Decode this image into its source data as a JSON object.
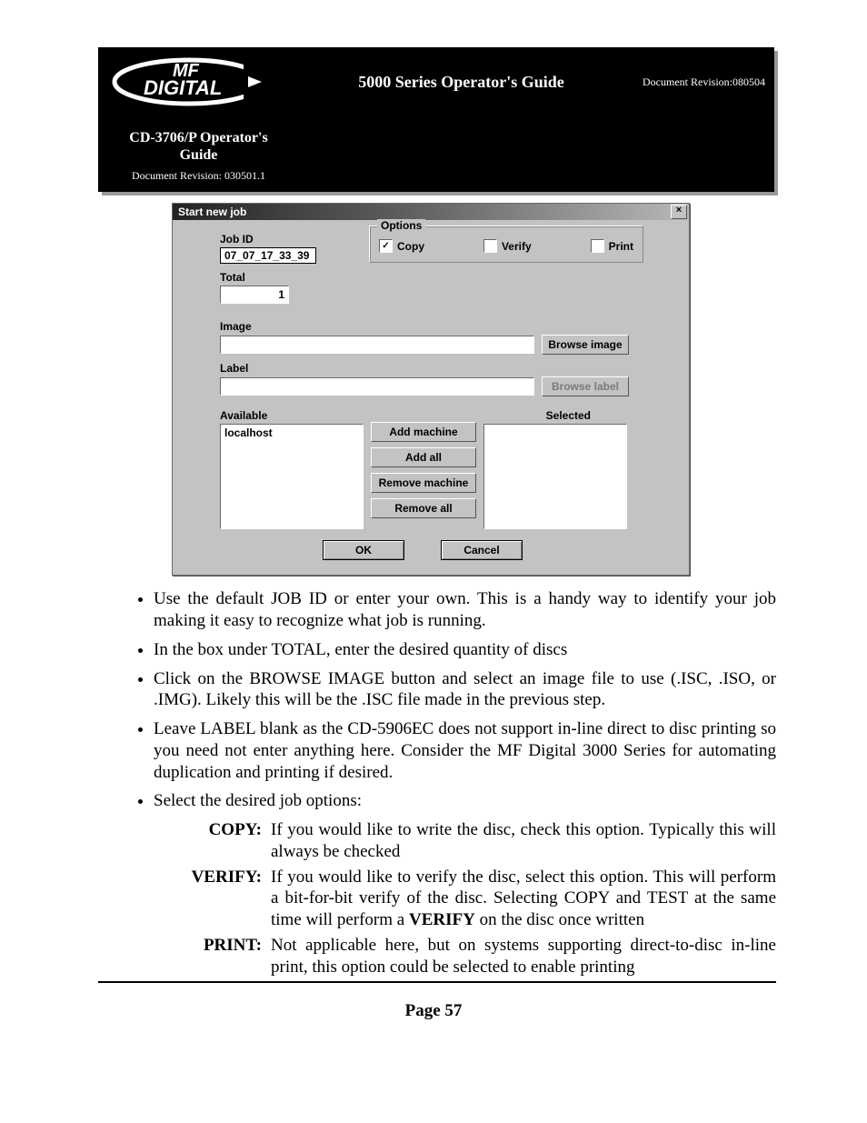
{
  "banner": {
    "main_title": "5000 Series Operator's Guide",
    "main_rev": "Document Revision:080504",
    "sub_title": "CD-3706/P Operator's Guide",
    "sub_rev": "Document Revision: 030501.1",
    "logo_top": "MF",
    "logo_bottom": "DIGITAL"
  },
  "dialog": {
    "title": "Start new job",
    "close": "×",
    "jobid_label": "Job ID",
    "jobid_value": "07_07_17_33_39",
    "total_label": "Total",
    "total_value": "1",
    "options_legend": "Options",
    "copy_label": "Copy",
    "copy_checked": "✓",
    "verify_label": "Verify",
    "print_label": "Print",
    "image_label": "Image",
    "browse_image": "Browse image",
    "label_label": "Label",
    "browse_label": "Browse label",
    "available_label": "Available",
    "selected_label": "Selected",
    "available_item": "localhost",
    "add_machine": "Add machine",
    "add_all": "Add all",
    "remove_machine": "Remove machine",
    "remove_all": "Remove all",
    "ok": "OK",
    "cancel": "Cancel"
  },
  "bullets": {
    "b1": "Use the default JOB ID or enter your own. This is a handy way to identify your job making it easy to recognize what job is running.",
    "b2": "In the box under TOTAL, enter the desired quantity of discs",
    "b3": "Click on the BROWSE IMAGE button and select an image file to use (.ISC, .ISO, or .IMG). Likely this will be the .ISC file made in the previous step.",
    "b4": "Leave LABEL blank as the CD-5906EC does not support in-line direct to disc printing so you need not enter anything here. Consider the MF Digital 3000 Series for automating duplication and printing if desired.",
    "b5": "Select the desired job options:"
  },
  "defs": {
    "copy_term": "COPY:",
    "copy_body": "If you would like to write the disc, check this option. Typically this will always be checked",
    "verify_term": "VERIFY:",
    "verify_body_1": "If you would like to verify the disc, select this option. This will perform a bit-for-bit verify of the disc. Selecting COPY and TEST at the same time will perform a ",
    "verify_bold": "VERIFY",
    "verify_body_2": " on the disc once written",
    "print_term": "PRINT:",
    "print_body": "Not applicable here, but on systems supporting direct-to-disc in-line print, this option could be selected to enable printing"
  },
  "page_no": "Page 57"
}
